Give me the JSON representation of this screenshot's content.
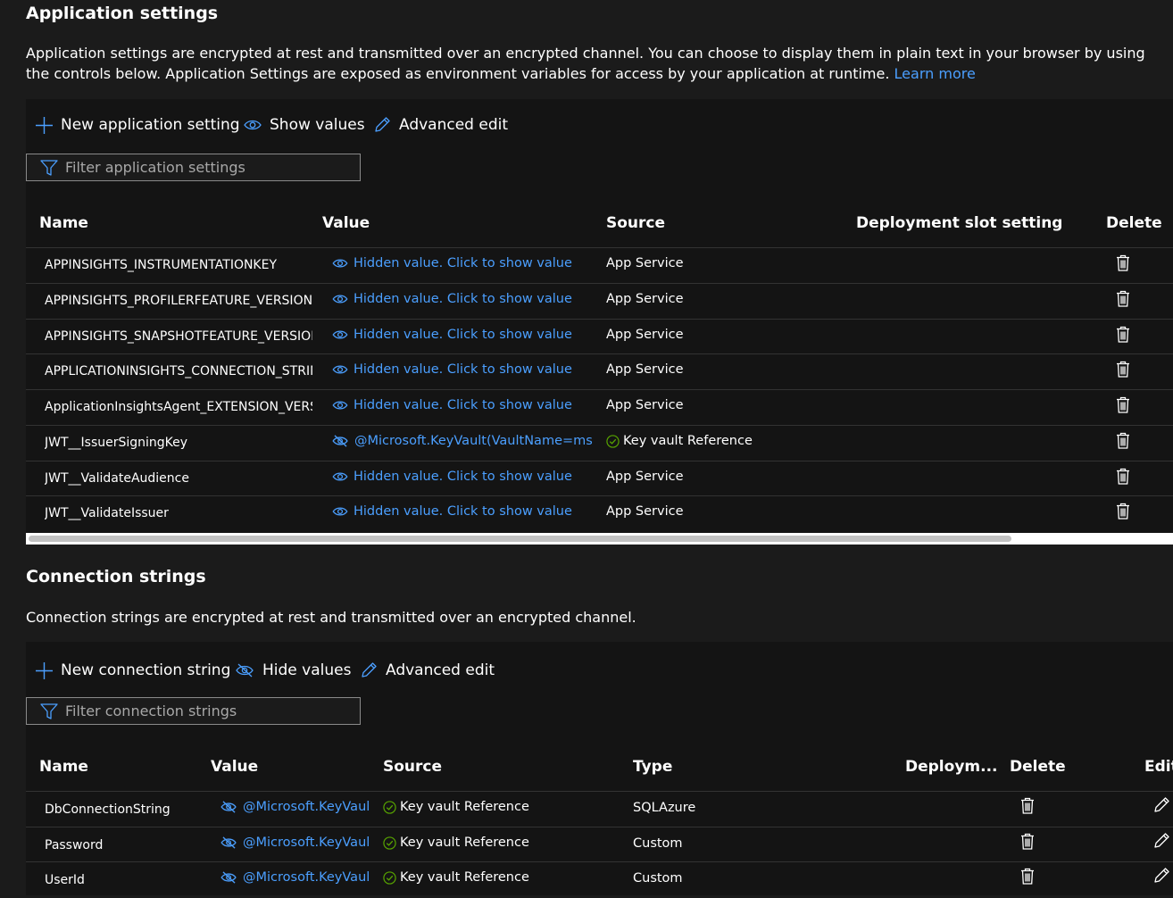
{
  "app_settings": {
    "title": "Application settings",
    "description": "Application settings are encrypted at rest and transmitted over an encrypted channel. You can choose to display them in plain text in your browser by using the controls below. Application Settings are exposed as environment variables for access by your application at runtime.",
    "learn_more": "Learn more",
    "toolbar": {
      "new_label": "New application setting",
      "show_values_label": "Show values",
      "advanced_edit_label": "Advanced edit"
    },
    "filter_placeholder": "Filter application settings",
    "columns": [
      "Name",
      "Value",
      "Source",
      "Deployment slot setting",
      "Delete"
    ],
    "rows": [
      {
        "name": "APPINSIGHTS_INSTRUMENTATIONKEY",
        "value": "Hidden value. Click to show value",
        "source": "App Service",
        "keyvault": false
      },
      {
        "name": "APPINSIGHTS_PROFILERFEATURE_VERSION",
        "value": "Hidden value. Click to show value",
        "source": "App Service",
        "keyvault": false
      },
      {
        "name": "APPINSIGHTS_SNAPSHOTFEATURE_VERSION",
        "value": "Hidden value. Click to show value",
        "source": "App Service",
        "keyvault": false
      },
      {
        "name": "APPLICATIONINSIGHTS_CONNECTION_STRIN",
        "value": "Hidden value. Click to show value",
        "source": "App Service",
        "keyvault": false
      },
      {
        "name": "ApplicationInsightsAgent_EXTENSION_VERSI(",
        "value": "Hidden value. Click to show value",
        "source": "App Service",
        "keyvault": false
      },
      {
        "name": "JWT__IssuerSigningKey",
        "value": "@Microsoft.KeyVault(VaultName=mshov",
        "source": "Key vault Reference",
        "keyvault": true
      },
      {
        "name": "JWT__ValidateAudience",
        "value": "Hidden value. Click to show value",
        "source": "App Service",
        "keyvault": false
      },
      {
        "name": "JWT__ValidateIssuer",
        "value": "Hidden value. Click to show value",
        "source": "App Service",
        "keyvault": false
      }
    ]
  },
  "conn_strings": {
    "title": "Connection strings",
    "description": "Connection strings are encrypted at rest and transmitted over an encrypted channel.",
    "toolbar": {
      "new_label": "New connection string",
      "hide_values_label": "Hide values",
      "advanced_edit_label": "Advanced edit"
    },
    "filter_placeholder": "Filter connection strings",
    "columns": [
      "Name",
      "Value",
      "Source",
      "Type",
      "Deploym...",
      "Delete",
      "Edit"
    ],
    "rows": [
      {
        "name": "DbConnectionString",
        "value": "@Microsoft.KeyVault(",
        "source": "Key vault Reference",
        "type": "SQLAzure"
      },
      {
        "name": "Password",
        "value": "@Microsoft.KeyVault(",
        "source": "Key vault Reference",
        "type": "Custom"
      },
      {
        "name": "UserId",
        "value": "@Microsoft.KeyVault(",
        "source": "Key vault Reference",
        "type": "Custom"
      }
    ]
  },
  "colors": {
    "background": "#1b1b1b",
    "toolbar": "#141414",
    "link": "#4b9fff",
    "accent": "#4b9fff",
    "success": "#57a300"
  },
  "icons": [
    "add-icon",
    "eye-icon",
    "eye-hide-icon",
    "pencil-icon",
    "filter-icon",
    "delete-icon",
    "check-circle-icon"
  ]
}
